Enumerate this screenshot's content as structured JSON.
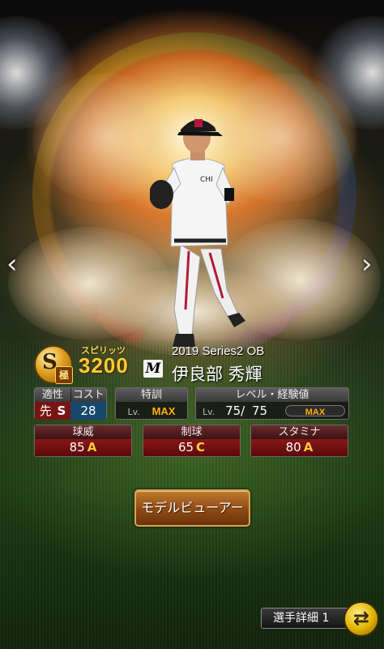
{
  "nav": {
    "prev_arrow": "‹",
    "next_arrow": "›"
  },
  "card": {
    "rank": "S",
    "rank_sub": "極",
    "spirits_label": "スピリッツ",
    "spirits_value": "3200",
    "team_logo": "M",
    "series": "2019 Series2 OB",
    "player_name": "伊良部 秀輝"
  },
  "aptitude": {
    "header_position": "適性",
    "header_cost": "コスト",
    "position": "先",
    "position_grade": "S",
    "cost": "28"
  },
  "training": {
    "header": "特訓",
    "lv_label": "Lv.",
    "value": "MAX"
  },
  "level": {
    "header": "レベル・経験値",
    "lv_label": "Lv.",
    "current": "75",
    "separator": "/",
    "max": "75",
    "exp_label": "MAX"
  },
  "stats": [
    {
      "name": "球威",
      "value": "85",
      "grade": "A",
      "grade_color": "#ffc83a"
    },
    {
      "name": "制球",
      "value": "65",
      "grade": "C",
      "grade_color": "#ffd23a"
    },
    {
      "name": "スタミナ",
      "value": "80",
      "grade": "A",
      "grade_color": "#ffc83a"
    }
  ],
  "buttons": {
    "model_viewer": "モデルビューアー",
    "player_detail": "選手詳細 1"
  },
  "colors": {
    "accent_gold": "#ffcc33",
    "max_orange": "#ffb000",
    "stat_red": "#8a1515"
  }
}
